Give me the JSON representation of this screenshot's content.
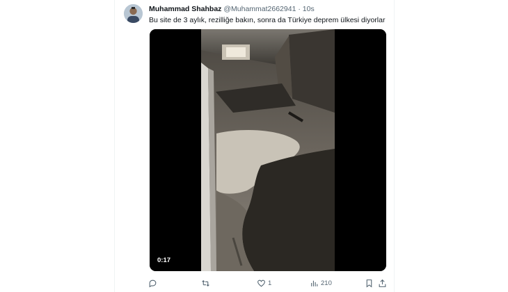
{
  "tweet": {
    "author_name": "Muhammad Shahbaz",
    "handle": "@Muhammat2662941",
    "separator": "·",
    "timestamp": "10s",
    "text": "Bu site de 3 aylık, rezilliğe bakın, sonra da Türkiye deprem ülkesi diyorlar",
    "media": {
      "type": "video",
      "duration": "0:17"
    },
    "actions": {
      "reply_count": "",
      "retweet_count": "",
      "like_count": "1",
      "view_count": "210"
    }
  },
  "icons": [
    "reply-icon",
    "retweet-icon",
    "like-icon",
    "views-icon",
    "bookmark-icon",
    "share-icon"
  ],
  "colors": {
    "text": "#0f1419",
    "secondary": "#536471",
    "border": "#eff3f4"
  }
}
